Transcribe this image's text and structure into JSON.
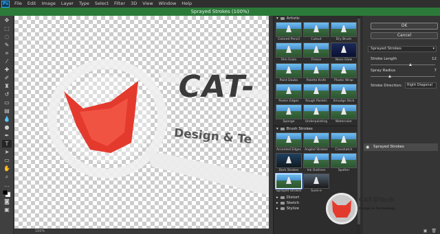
{
  "app": {
    "logo": "Ps",
    "menu": [
      "File",
      "Edit",
      "Image",
      "Layer",
      "Type",
      "Select",
      "Filter",
      "3D",
      "View",
      "Window",
      "Help"
    ],
    "title": "Sprayed Strokes (100%)"
  },
  "canvas": {
    "logo_text": "CAT-",
    "tagline": "Design & Te",
    "zoom": "100%"
  },
  "gallery": {
    "folders": [
      {
        "name": "Artistic",
        "items": [
          "Colored Pencil",
          "Cutout",
          "Dry Brush",
          "Film Grain",
          "Fresco",
          "Neon Glow",
          "Paint Daubs",
          "Palette Knife",
          "Plastic Wrap",
          "Poster Edges",
          "Rough Pastels",
          "Smudge Stick",
          "Sponge",
          "Underpainting",
          "Watercolor"
        ]
      },
      {
        "name": "Brush Strokes",
        "items": [
          "Accented Edges",
          "Angled Strokes",
          "Crosshatch",
          "Dark Strokes",
          "Ink Outlines",
          "Spatter",
          "Sprayed Strokes",
          "Sumi-e"
        ]
      }
    ],
    "collapsed": [
      "Distort",
      "Sketch",
      "Stylize"
    ]
  },
  "panel": {
    "ok": "OK",
    "cancel": "Cancel",
    "filter": "Sprayed Strokes",
    "stroke_length_label": "Stroke Length",
    "stroke_length": "12",
    "stroke_length_frac": 0.6,
    "spray_radius_label": "Spray Radius",
    "spray_radius": "7",
    "spray_radius_frac": 0.28,
    "direction_label": "Stroke Direction:",
    "direction": "Right Diagonal",
    "layer": "Sprayed Strokes"
  },
  "watermark": {
    "title": "CAT-DTech",
    "sub": "Design & Technology"
  },
  "colors": {
    "title_bar": "#2c7a3a",
    "accent_red": "#e43a2e"
  }
}
